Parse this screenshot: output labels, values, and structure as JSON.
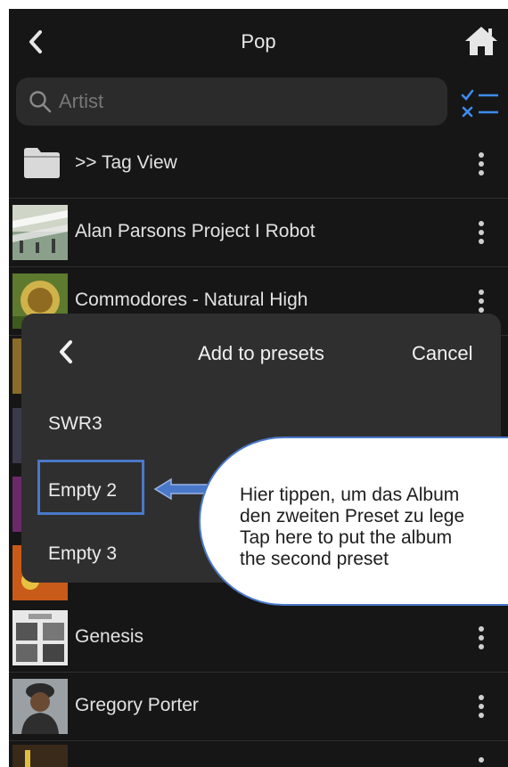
{
  "nav": {
    "title": "Pop"
  },
  "search": {
    "placeholder": "Artist"
  },
  "rows": [
    {
      "label": ">> Tag View"
    },
    {
      "label": "Alan Parsons Project I Robot"
    },
    {
      "label": "Commodores - Natural High"
    },
    {
      "label": "Genesis"
    },
    {
      "label": "Gregory Porter"
    }
  ],
  "sheet": {
    "title": "Add to presets",
    "cancel": "Cancel",
    "presets": [
      "SWR3",
      "Empty 2",
      "Empty 3"
    ]
  },
  "callout": {
    "line1": "Hier tippen, um das Album",
    "line2": "den zweiten Preset zu lege",
    "line3": "Tap here to put the album",
    "line4": "the second preset"
  },
  "colors": {
    "background": "#161616",
    "sheet": "#2f2f2f",
    "accent": "#4a78c8",
    "checklist_blue": "#3d8cf0"
  },
  "icons": [
    "back-chevron-icon",
    "home-icon",
    "search-icon",
    "checklist-icon",
    "folder-icon",
    "more-vertical-icon"
  ]
}
